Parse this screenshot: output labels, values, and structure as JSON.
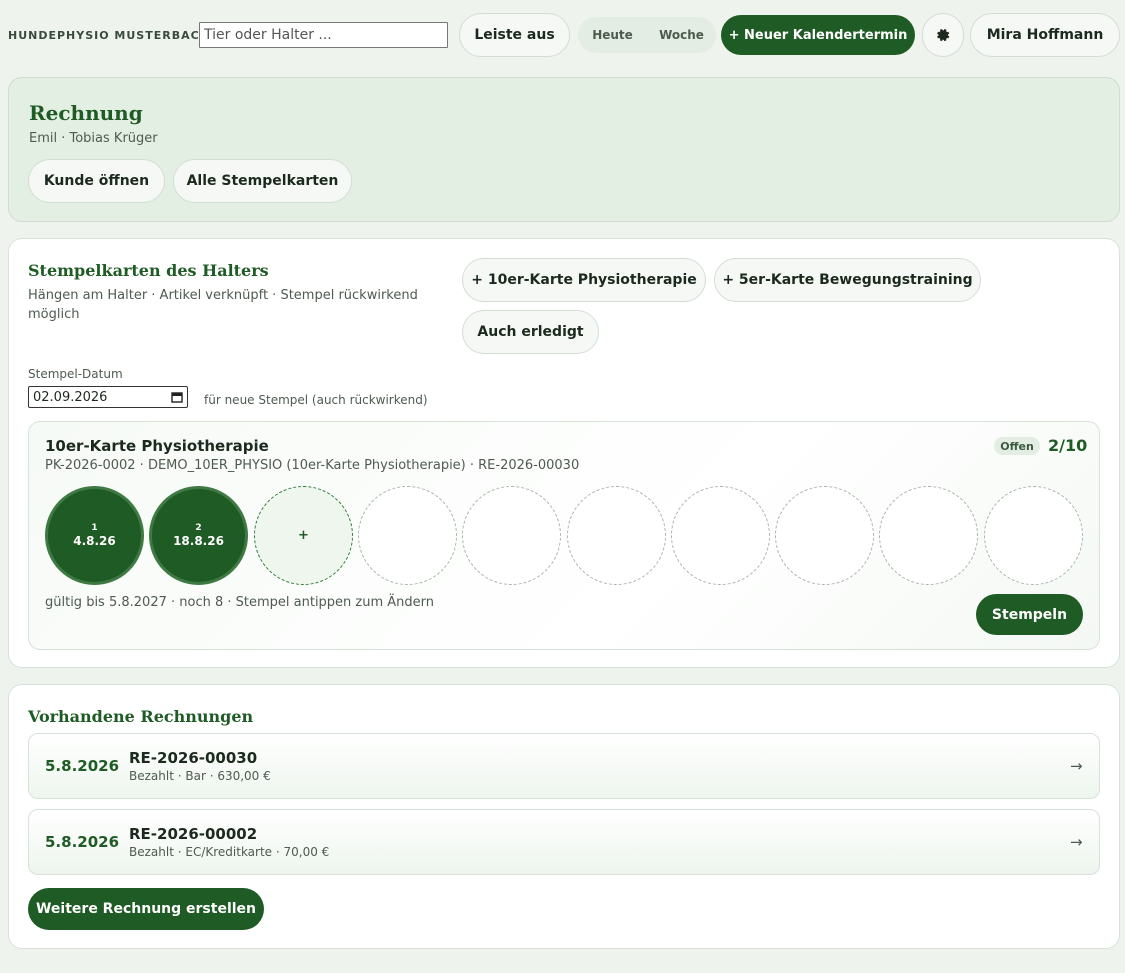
{
  "topbar": {
    "brand": "HUNDEPHYSIO MUSTERBACH",
    "search_placeholder": "Tier oder Halter ...",
    "sidebar_toggle": "Leiste aus",
    "view_today": "Heute",
    "view_week": "Woche",
    "new_appointment": "+ Neuer Kalendertermin",
    "settings_icon": "gear-icon",
    "user_name": "Mira Hoffmann"
  },
  "hero": {
    "title": "Rechnung",
    "subtitle": "Emil · Tobias Krüger",
    "open_customer": "Kunde öffnen",
    "all_stampcards": "Alle Stempelkarten"
  },
  "stampcards": {
    "title": "Stempelkarten des Halters",
    "subtitle_line1": "Hängen am Halter · Artikel verknüpft · Stempel rückwirkend",
    "subtitle_line2": "möglich",
    "add_10er": "+ 10er-Karte Physiotherapie",
    "add_5er": "+ 5er-Karte Bewegungstraining",
    "also_done": "Auch erledigt",
    "date_label": "Stempel-Datum",
    "date_value": "02.09.2026",
    "date_hint": "für neue Stempel (auch rückwirkend)",
    "card": {
      "name": "10er-Karte Physiotherapie",
      "meta": "PK-2026-0002 · DEMO_10ER_PHYSIO (10er-Karte Physiotherapie) · RE-2026-00030",
      "status": "Offen",
      "count": "2/10",
      "used": 2,
      "total": 10,
      "stamps": [
        {
          "n": "1",
          "date": "4.8.26"
        },
        {
          "n": "2",
          "date": "18.8.26"
        }
      ],
      "next_label": "+",
      "footer": "gültig bis 5.8.2027 · noch 8 · Stempel antippen zum Ändern",
      "stamp_button": "Stempeln"
    }
  },
  "invoices": {
    "title": "Vorhandene Rechnungen",
    "rows": [
      {
        "date": "5.8.2026",
        "number": "RE-2026-00030",
        "detail": "Bezahlt · Bar · 630,00 €",
        "arrow": "→"
      },
      {
        "date": "5.8.2026",
        "number": "RE-2026-00002",
        "detail": "Bezahlt · EC/Kreditkarte · 70,00 €",
        "arrow": "→"
      }
    ],
    "create_button": "Weitere Rechnung erstellen"
  },
  "colors": {
    "accent": "#1f5b24",
    "background": "#eef3ee",
    "hero_background": "#e4efe4"
  }
}
